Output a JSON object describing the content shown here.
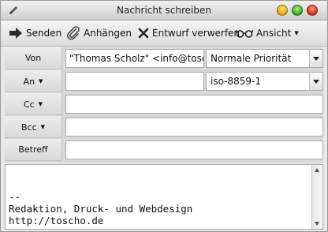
{
  "window": {
    "title": "Nachricht schreiben"
  },
  "toolbar": {
    "send_label": "Senden",
    "attach_label": "Anhängen",
    "discard_label": "Entwurf verwerfen",
    "view_label": "Ansicht"
  },
  "headers": {
    "from": {
      "label": "Von",
      "value": "\"Thomas Scholz\" <info@toscho.de>",
      "priority": "Normale Priorität"
    },
    "to": {
      "label": "An",
      "value": "",
      "charset": "iso-8859-1"
    },
    "cc": {
      "label": "Cc",
      "value": ""
    },
    "bcc": {
      "label": "Bcc",
      "value": ""
    },
    "subject": {
      "label": "Betreff",
      "value": ""
    }
  },
  "body": {
    "lines": [
      "--",
      "Redaktion, Druck- und Webdesign",
      "http://toscho.de"
    ]
  },
  "icons": {
    "window_icon": "pencil-icon",
    "send": "send-arrow-icon",
    "attach": "paperclip-icon",
    "discard": "x-icon",
    "view": "glasses-icon"
  }
}
